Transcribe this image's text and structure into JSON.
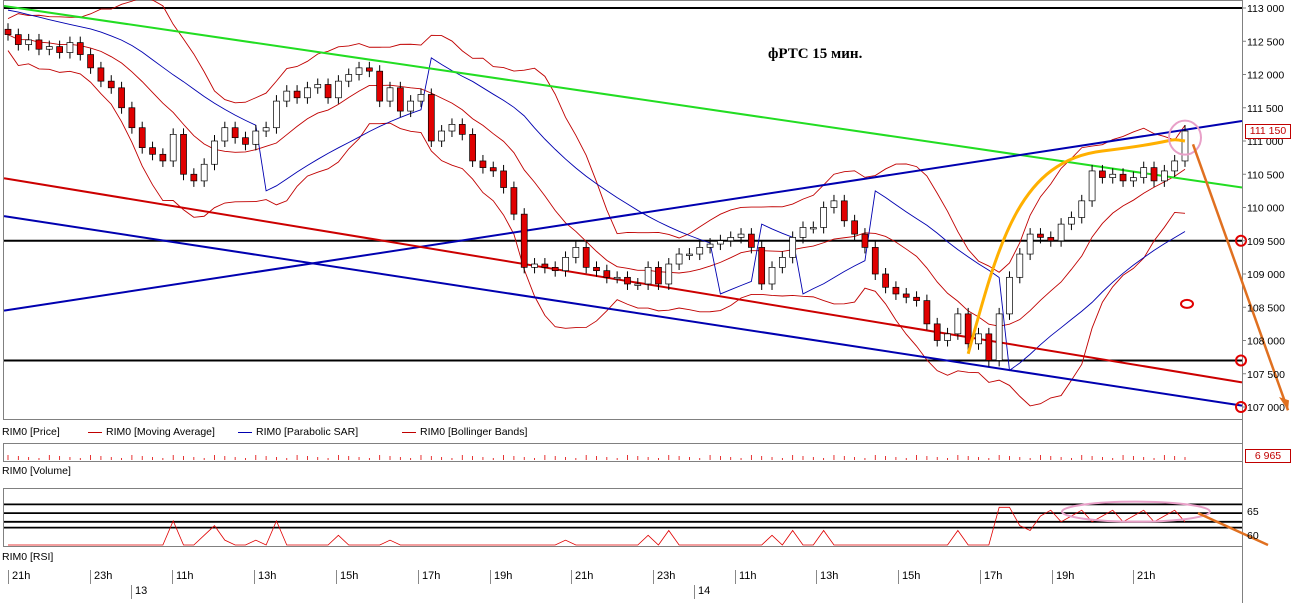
{
  "title": "фРТС   15 мин.",
  "legend": [
    {
      "label": "RIM0 [Price]",
      "color": "#000000",
      "swatch": false
    },
    {
      "label": "RIM0 [Moving Average]",
      "color": "#c00000",
      "swatch": true
    },
    {
      "label": "RIM0 [Parabolic SAR]",
      "color": "#0000b0",
      "swatch": true
    },
    {
      "label": "RIM0 [Bollinger Bands]",
      "color": "#c00000",
      "swatch": true
    }
  ],
  "panels": {
    "volume_label": "RIM0 [Volume]",
    "volume_value": "6 965",
    "rsi_label": "RIM0 [RSI]",
    "rsi_ticks": [
      "65",
      "60"
    ]
  },
  "last_price": "111 150",
  "time_axis": {
    "hours": [
      "21h",
      "23h",
      "11h",
      "13h",
      "15h",
      "17h",
      "19h",
      "21h",
      "23h",
      "11h",
      "13h",
      "15h",
      "17h",
      "19h",
      "21h"
    ],
    "days": [
      "13",
      "14"
    ]
  },
  "colors": {
    "up_candle": "#ffffff",
    "down_candle": "#e00000",
    "sar": "#0000b0",
    "bands": "#c00000",
    "green_line": "#22dd22",
    "channel_blue": "#0000b0",
    "channel_red": "#cc0000",
    "orange": "#e07020",
    "yellow": "#ffb000",
    "pink_marker": "#e8a0c8"
  },
  "chart_data": {
    "type": "candlestick",
    "title": "фРТС   15 мин.",
    "y_ticks": [
      113000,
      112500,
      112000,
      111500,
      111000,
      110500,
      110000,
      109500,
      109000,
      108500,
      108000,
      107500,
      107000
    ],
    "ylim": [
      106830,
      113050
    ],
    "horizontal_levels": [
      113000,
      109500,
      107700
    ],
    "trendlines": [
      {
        "color": "#22dd22",
        "from": [
          0,
          113030
        ],
        "to": [
          1,
          110300
        ]
      },
      {
        "color": "#0000b0",
        "from": [
          0,
          108450
        ],
        "to": [
          1,
          111300
        ]
      },
      {
        "color": "#0000b0",
        "from": [
          0,
          109870
        ],
        "to": [
          1,
          107020
        ]
      },
      {
        "color": "#cc0000",
        "from": [
          0,
          110440
        ],
        "to": [
          1,
          107370
        ]
      }
    ],
    "close": [
      112600,
      112450,
      112520,
      112380,
      112420,
      112330,
      112480,
      112300,
      112100,
      111900,
      111800,
      111500,
      111200,
      110900,
      110800,
      110700,
      111100,
      110500,
      110400,
      110650,
      111000,
      111200,
      111050,
      110950,
      111150,
      111200,
      111600,
      111750,
      111650,
      111800,
      111850,
      111650,
      111900,
      112000,
      112100,
      112050,
      111600,
      111800,
      111450,
      111600,
      111700,
      111000,
      111150,
      111250,
      111100,
      110700,
      110600,
      110550,
      110300,
      109900,
      109100,
      109150,
      109100,
      109050,
      109250,
      109400,
      109100,
      109050,
      108950,
      108950,
      108850,
      108850,
      109100,
      108850,
      109150,
      109300,
      109300,
      109400,
      109450,
      109500,
      109550,
      109600,
      109400,
      108850,
      109100,
      109250,
      109550,
      109700,
      109700,
      110000,
      110100,
      109800,
      109600,
      109400,
      109000,
      108800,
      108700,
      108650,
      108600,
      108250,
      108000,
      108100,
      108400,
      107950,
      108100,
      107700,
      108400,
      108950,
      109300,
      109600,
      109550,
      109500,
      109750,
      109850,
      110100,
      110550,
      110450,
      110500,
      110400,
      110450,
      110600,
      110400,
      110550,
      110700,
      111150
    ],
    "volume_value": 6965,
    "rsi_levels": [
      69,
      66,
      63,
      61
    ]
  }
}
